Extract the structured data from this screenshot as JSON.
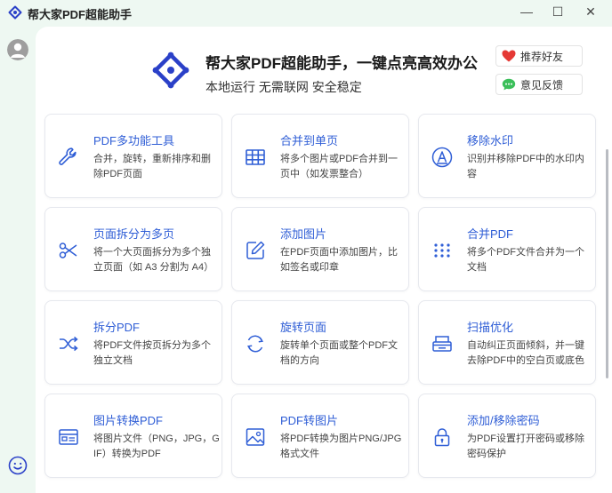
{
  "app": {
    "title": "帮大家PDF超能助手"
  },
  "window": {
    "minimize": "—",
    "maximize": "☐",
    "close": "✕"
  },
  "header": {
    "title": "帮大家PDF超能助手，一键点亮高效办公",
    "subtitle": "本地运行 无需联网 安全稳定",
    "recommend_label": "推荐好友",
    "feedback_label": "意见反馈"
  },
  "colors": {
    "accent": "#2f5ed6",
    "logo": "#2a40c8",
    "heart": "#e53935",
    "feedback": "#3bbf5a",
    "bg": "#eef8f2"
  },
  "cards": [
    {
      "title": "PDF多功能工具",
      "desc": "合并，旋转，重新排序和删除PDF页面",
      "icon": "wrench-icon"
    },
    {
      "title": "合并到单页",
      "desc": "将多个图片或PDF合并到一页中（如发票整合）",
      "icon": "table-icon"
    },
    {
      "title": "移除水印",
      "desc": "识别并移除PDF中的水印内容",
      "icon": "watermark-icon"
    },
    {
      "title": "页面拆分为多页",
      "desc": "将一个大页面拆分为多个独立页面（如 A3 分割为 A4）",
      "icon": "scissors-icon"
    },
    {
      "title": "添加图片",
      "desc": "在PDF页面中添加图片，比如签名或印章",
      "icon": "edit-icon"
    },
    {
      "title": "合并PDF",
      "desc": "将多个PDF文件合并为一个文档",
      "icon": "dots-grid-icon"
    },
    {
      "title": "拆分PDF",
      "desc": "将PDF文件按页拆分为多个独立文档",
      "icon": "shuffle-icon"
    },
    {
      "title": "旋转页面",
      "desc": "旋转单个页面或整个PDF文档的方向",
      "icon": "rotate-icon"
    },
    {
      "title": "扫描优化",
      "desc": "自动纠正页面倾斜，并一键去除PDF中的空白页或底色",
      "icon": "scanner-icon"
    },
    {
      "title": "图片转换PDF",
      "desc": "将图片文件（PNG，JPG，GIF）转换为PDF",
      "icon": "image-card-icon"
    },
    {
      "title": "PDF转图片",
      "desc": "将PDF转换为图片PNG/JPG格式文件",
      "icon": "picture-icon"
    },
    {
      "title": "添加/移除密码",
      "desc": "为PDF设置打开密码或移除密码保护",
      "icon": "lock-icon"
    }
  ]
}
